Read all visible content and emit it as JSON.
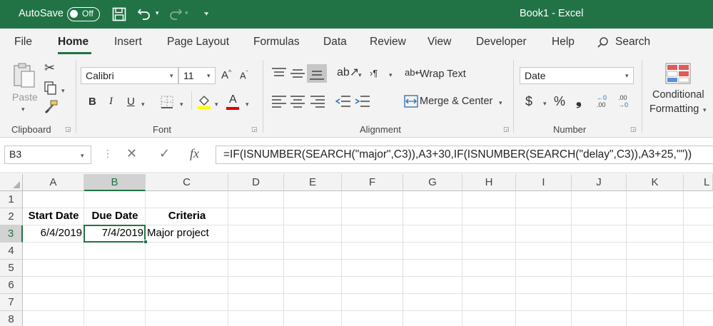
{
  "titlebar": {
    "autosave_label": "AutoSave",
    "autosave_state": "Off",
    "title": "Book1  -  Excel"
  },
  "tabs": [
    "File",
    "Home",
    "Insert",
    "Page Layout",
    "Formulas",
    "Data",
    "Review",
    "View",
    "Developer",
    "Help"
  ],
  "active_tab": "Home",
  "search_label": "Search",
  "ribbon": {
    "clipboard": {
      "paste_label": "Paste",
      "group_label": "Clipboard"
    },
    "font": {
      "font_name": "Calibri",
      "font_size": "11",
      "group_label": "Font",
      "bold": "B",
      "italic": "I",
      "underline": "U",
      "font_color_letter": "A",
      "grow": "A",
      "shrink": "A"
    },
    "alignment": {
      "wrap_text": "Wrap Text",
      "merge_center": "Merge & Center",
      "group_label": "Alignment"
    },
    "number": {
      "format": "Date",
      "currency": "$",
      "percent": "%",
      "comma": "❟",
      "group_label": "Number",
      "inc_dec": ".00",
      "dec_dec": ".00",
      "inc_dec2": "←0",
      "dec_dec2": "→0"
    },
    "styles": {
      "cond_format_line1": "Conditional",
      "cond_format_line2": "Formatting"
    },
    "accent_color": "#217346"
  },
  "formula_bar": {
    "name_box": "B3",
    "fx": "fx",
    "formula": "=IF(ISNUMBER(SEARCH(\"major\",C3)),A3+30,IF(ISNUMBER(SEARCH(\"delay\",C3)),A3+25,\"\"))"
  },
  "grid": {
    "columns": [
      "A",
      "B",
      "C",
      "D",
      "E",
      "F",
      "G",
      "H",
      "I",
      "J",
      "K",
      "L"
    ],
    "rows": [
      "1",
      "2",
      "3",
      "4",
      "5",
      "6",
      "7",
      "8"
    ],
    "selected_cell": "B3",
    "cells": {
      "A2": "Start Date",
      "B2": "Due Date",
      "C2": "Criteria",
      "A3": "6/4/2019",
      "B3": "7/4/2019",
      "C3": "Major project"
    }
  }
}
